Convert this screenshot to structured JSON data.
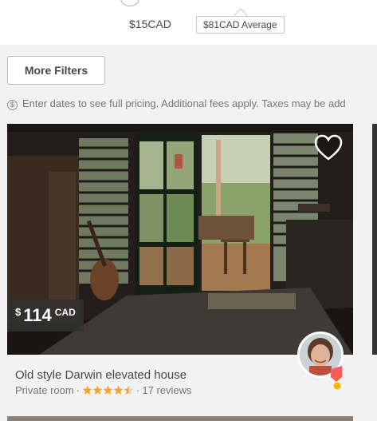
{
  "price_filter": {
    "min_price": "$15CAD",
    "average_label": "$81CAD Average"
  },
  "filters": {
    "more_filters_label": "More Filters"
  },
  "pricing_note": {
    "icon": "dollar-circle-icon",
    "text": "Enter dates to see full pricing. Additional fees apply. Taxes may be add"
  },
  "listing": {
    "price_symbol": "$",
    "price": "114",
    "currency": "CAD",
    "title": "Old style Darwin elevated house",
    "room_type": "Private room",
    "separator": "·",
    "rating": 4.5,
    "reviews": "17 reviews",
    "star_color": "#f5a623",
    "superhost_colors": [
      "#ff5a5f",
      "#ffb400"
    ]
  }
}
